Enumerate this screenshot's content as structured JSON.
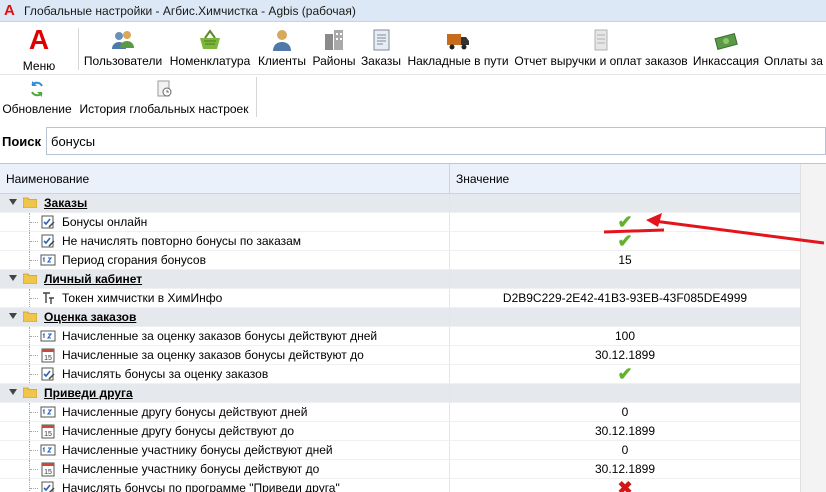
{
  "window": {
    "title": "Глобальные настройки - Агбис.Химчистка - Agbis (рабочая)"
  },
  "toolbar": {
    "menu_label": "Меню",
    "items": [
      {
        "label": "Пользователи",
        "icon": "users-icon"
      },
      {
        "label": "Номенклатура",
        "icon": "basket-icon"
      },
      {
        "label": "Клиенты",
        "icon": "client-icon"
      },
      {
        "label": "Районы",
        "icon": "buildings-icon"
      },
      {
        "label": "Заказы",
        "icon": "orders-icon"
      },
      {
        "label": "Накладные в пути",
        "icon": "truck-icon"
      },
      {
        "label": "Отчет выручки и оплат заказов",
        "icon": "report-icon"
      },
      {
        "label": "Инкассация",
        "icon": "money-icon"
      },
      {
        "label": "Оплаты за",
        "icon": "payments-icon"
      }
    ],
    "row2": [
      {
        "label": "Обновление",
        "icon": "refresh-icon"
      },
      {
        "label": "История глобальных настроек",
        "icon": "history-icon"
      }
    ]
  },
  "search": {
    "label": "Поиск",
    "value": "бонусы"
  },
  "grid": {
    "col_name": "Наименование",
    "col_value": "Значение",
    "rows": [
      {
        "type": "group",
        "name": "Заказы",
        "value": ""
      },
      {
        "type": "item",
        "icon": "bool",
        "name": "Бонусы онлайн",
        "value": "check"
      },
      {
        "type": "item",
        "icon": "bool",
        "name": "Не начислять повторно бонусы по заказам",
        "value": "check"
      },
      {
        "type": "item",
        "icon": "num",
        "name": "Период сгорания бонусов",
        "value": "15"
      },
      {
        "type": "group",
        "name": "Личный кабинет",
        "value": ""
      },
      {
        "type": "item",
        "icon": "text",
        "name": "Токен химчистки в ХимИнфо",
        "value": "D2B9C229-2E42-41B3-93EB-43F085DE4999"
      },
      {
        "type": "group",
        "name": "Оценка заказов",
        "value": ""
      },
      {
        "type": "item",
        "icon": "num",
        "name": "Начисленные за оценку заказов бонусы действуют дней",
        "value": "100"
      },
      {
        "type": "item",
        "icon": "date",
        "name": "Начисленные за оценку заказов бонусы действуют до",
        "value": "30.12.1899"
      },
      {
        "type": "item",
        "icon": "bool",
        "name": "Начислять бонусы за оценку заказов",
        "value": "check"
      },
      {
        "type": "group",
        "name": "Приведи друга",
        "value": ""
      },
      {
        "type": "item",
        "icon": "num",
        "name": "Начисленные другу бонусы действуют дней",
        "value": "0"
      },
      {
        "type": "item",
        "icon": "date",
        "name": "Начисленные другу бонусы действуют до",
        "value": "30.12.1899"
      },
      {
        "type": "item",
        "icon": "num",
        "name": "Начисленные участнику бонусы действуют дней",
        "value": "0"
      },
      {
        "type": "item",
        "icon": "date",
        "name": "Начисленные участнику бонусы действуют до",
        "value": "30.12.1899"
      },
      {
        "type": "item",
        "icon": "bool",
        "name": "Начислять бонусы по программе \"Приведи друга\"",
        "value": "cross"
      }
    ]
  },
  "colors": {
    "accent_red": "#e00000",
    "check_green": "#62b22b",
    "cross_red": "#d01818",
    "header_bg": "#eaf1fa",
    "group_bg": "#e5e8ec"
  }
}
